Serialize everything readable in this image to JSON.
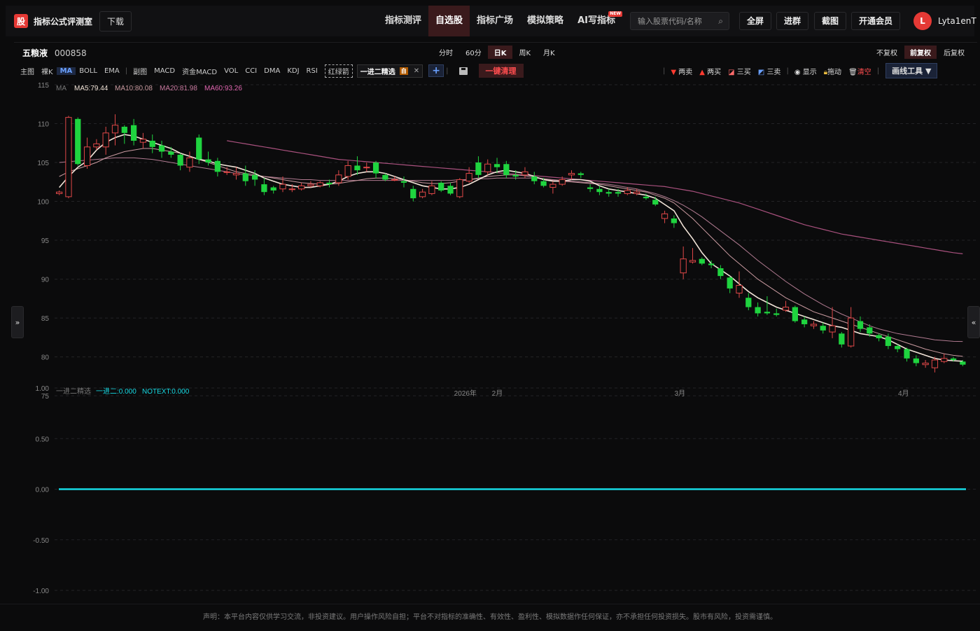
{
  "app": {
    "logo_char": "股",
    "brand": "指标公式评测室",
    "download": "下载"
  },
  "nav": {
    "items": [
      {
        "label": "指标测评"
      },
      {
        "label": "自选股",
        "active": true
      },
      {
        "label": "指标广场"
      },
      {
        "label": "模拟策略"
      },
      {
        "label": "AI写指标",
        "badge": "NEW"
      }
    ]
  },
  "search": {
    "placeholder": "输入股票代码/名称"
  },
  "top_buttons": {
    "fullscreen": "全屏",
    "join_group": "进群",
    "screenshot": "截图",
    "vip": "开通会员"
  },
  "user": {
    "avatar_letter": "L",
    "name": "Lyta1enT"
  },
  "stock": {
    "name": "五粮液",
    "code": "000858"
  },
  "periods": [
    "分时",
    "60分",
    "日K",
    "周K",
    "月K"
  ],
  "active_period": "日K",
  "adjust": [
    "不复权",
    "前复权",
    "后复权"
  ],
  "active_adjust": "前复权",
  "toolbar": {
    "main_label": "主图",
    "bare_k": "裸K",
    "ma": "MA",
    "boll": "BOLL",
    "ema": "EMA",
    "sub_label": "副图",
    "macd": "MACD",
    "fund_macd": "资金MACD",
    "vol": "VOL",
    "cci": "CCI",
    "dma": "DMA",
    "kdj": "KDJ",
    "rsi": "RSI",
    "red_green_arrow": "红绿箭",
    "chip_label": "一进二精选",
    "chip_badge": "自",
    "clear_all": "一键清理",
    "two_sell": "两卖",
    "two_buy": "两买",
    "three_buy": "三买",
    "three_sell": "三卖",
    "show": "显示",
    "drag": "拖动",
    "clear": "清空",
    "draw_tools": "画线工具 ▼"
  },
  "ma_legend": {
    "label": "MA",
    "ma5": "MA5:79.44",
    "ma10": "MA10:80.08",
    "ma20": "MA20:81.98",
    "ma60": "MA60:93.26"
  },
  "sub_legend": {
    "label": "一进二精选",
    "v1": "一进二:0.000",
    "v2": "NOTEXT:0.000"
  },
  "colors": {
    "up": "#e04848",
    "down": "#1fd43f",
    "ma5": "#f2e4d8",
    "ma10": "#c99aa0",
    "ma20": "#b07a90",
    "ma60": "#a9517e",
    "cyan": "#16d9e3",
    "accent_red": "#ff4d4f"
  },
  "chart_data": {
    "type": "candlestick",
    "ylim": [
      76,
      115
    ],
    "yticks": [
      115,
      110,
      105,
      100,
      95,
      90,
      85,
      80,
      75
    ],
    "xlabels": [
      "2026年",
      "2月",
      "3月",
      "4月"
    ],
    "candles": [
      [
        101.0,
        101.2,
        100.8,
        101.4
      ],
      [
        100.6,
        110.8,
        100.4,
        111.0
      ],
      [
        110.6,
        104.8,
        104.6,
        110.8
      ],
      [
        104.6,
        107.0,
        104.2,
        108.2
      ],
      [
        107.0,
        107.4,
        106.6,
        108.0
      ],
      [
        107.0,
        108.8,
        106.0,
        109.6
      ],
      [
        108.8,
        109.8,
        107.2,
        111.2
      ],
      [
        109.6,
        108.8,
        107.4,
        109.8
      ],
      [
        109.8,
        107.8,
        107.2,
        110.6
      ],
      [
        107.6,
        108.0,
        106.8,
        108.8
      ],
      [
        107.8,
        107.0,
        106.2,
        108.6
      ],
      [
        107.2,
        106.4,
        105.6,
        107.8
      ],
      [
        106.4,
        106.0,
        105.6,
        107.0
      ],
      [
        106.0,
        104.6,
        104.0,
        106.2
      ],
      [
        104.4,
        105.6,
        103.8,
        106.4
      ],
      [
        108.2,
        105.4,
        104.8,
        108.6
      ],
      [
        105.4,
        105.0,
        104.6,
        106.4
      ],
      [
        105.2,
        103.8,
        103.2,
        105.6
      ],
      [
        103.8,
        103.8,
        103.4,
        104.4
      ],
      [
        103.4,
        103.6,
        102.8,
        104.4
      ],
      [
        103.6,
        102.6,
        102.0,
        104.6
      ],
      [
        103.4,
        102.8,
        102.0,
        104.0
      ],
      [
        102.2,
        101.2,
        100.8,
        103.0
      ],
      [
        101.8,
        101.4,
        101.0,
        102.0
      ],
      [
        101.6,
        102.2,
        101.2,
        103.2
      ],
      [
        101.6,
        101.6,
        101.2,
        102.2
      ],
      [
        101.6,
        102.0,
        101.4,
        102.4
      ],
      [
        102.0,
        102.2,
        101.8,
        102.6
      ],
      [
        102.0,
        102.4,
        101.8,
        102.6
      ],
      [
        102.4,
        102.2,
        101.8,
        102.8
      ],
      [
        102.4,
        103.4,
        102.0,
        104.0
      ],
      [
        103.2,
        104.6,
        102.8,
        105.2
      ],
      [
        104.6,
        104.0,
        103.4,
        105.8
      ],
      [
        104.4,
        104.4,
        103.8,
        105.0
      ],
      [
        105.0,
        103.6,
        103.0,
        105.2
      ],
      [
        103.4,
        102.8,
        102.6,
        103.6
      ],
      [
        102.8,
        102.8,
        102.6,
        103.2
      ],
      [
        102.6,
        102.4,
        101.8,
        103.2
      ],
      [
        101.6,
        100.4,
        100.0,
        102.0
      ],
      [
        100.6,
        101.2,
        100.4,
        101.6
      ],
      [
        101.0,
        102.0,
        100.8,
        102.6
      ],
      [
        102.4,
        101.4,
        101.2,
        102.6
      ],
      [
        102.0,
        101.0,
        100.8,
        102.4
      ],
      [
        100.6,
        102.8,
        100.4,
        103.0
      ],
      [
        102.6,
        103.6,
        102.4,
        104.4
      ],
      [
        105.0,
        103.4,
        103.0,
        105.8
      ],
      [
        103.8,
        104.8,
        103.4,
        105.4
      ],
      [
        104.8,
        104.4,
        103.6,
        105.6
      ],
      [
        104.8,
        103.4,
        103.0,
        105.2
      ],
      [
        103.4,
        103.2,
        102.8,
        104.0
      ],
      [
        103.4,
        103.8,
        103.0,
        104.4
      ],
      [
        103.2,
        102.6,
        102.2,
        103.8
      ],
      [
        102.6,
        102.0,
        101.8,
        103.0
      ],
      [
        101.8,
        102.2,
        101.0,
        102.6
      ],
      [
        102.2,
        102.8,
        102.0,
        103.2
      ],
      [
        103.4,
        103.6,
        102.8,
        104.0
      ],
      [
        103.6,
        103.4,
        103.0,
        103.8
      ],
      [
        101.8,
        101.6,
        101.2,
        102.2
      ],
      [
        101.6,
        101.2,
        100.8,
        102.0
      ],
      [
        101.2,
        101.0,
        100.6,
        101.6
      ],
      [
        101.2,
        101.0,
        100.6,
        101.6
      ],
      [
        101.0,
        101.4,
        100.8,
        101.8
      ],
      [
        101.0,
        101.2,
        100.8,
        101.6
      ],
      [
        100.6,
        100.4,
        100.2,
        101.0
      ],
      [
        100.2,
        99.6,
        99.4,
        100.6
      ],
      [
        97.8,
        98.4,
        97.2,
        98.8
      ],
      [
        97.8,
        97.2,
        96.6,
        98.2
      ],
      [
        90.8,
        92.6,
        90.0,
        94.2
      ],
      [
        92.2,
        92.4,
        92.0,
        94.0
      ],
      [
        92.6,
        92.0,
        91.8,
        92.8
      ],
      [
        92.0,
        91.8,
        91.4,
        92.4
      ],
      [
        91.4,
        90.4,
        90.0,
        91.8
      ],
      [
        90.2,
        88.8,
        88.2,
        90.4
      ],
      [
        88.2,
        89.2,
        87.6,
        91.0
      ],
      [
        87.6,
        86.4,
        86.0,
        88.2
      ],
      [
        86.4,
        85.6,
        85.2,
        87.0
      ],
      [
        85.8,
        85.6,
        85.4,
        87.8
      ],
      [
        85.6,
        85.4,
        85.2,
        86.2
      ],
      [
        86.0,
        86.4,
        85.8,
        87.2
      ],
      [
        86.4,
        84.6,
        84.4,
        86.6
      ],
      [
        84.8,
        84.2,
        83.8,
        85.2
      ],
      [
        84.0,
        84.2,
        83.6,
        84.6
      ],
      [
        84.0,
        83.4,
        83.0,
        84.4
      ],
      [
        83.2,
        84.0,
        82.4,
        86.4
      ],
      [
        83.0,
        81.6,
        81.2,
        83.2
      ],
      [
        81.4,
        85.0,
        81.2,
        86.4
      ],
      [
        84.6,
        83.6,
        83.2,
        85.2
      ],
      [
        83.8,
        83.0,
        82.6,
        84.2
      ],
      [
        82.8,
        82.4,
        82.0,
        83.0
      ],
      [
        82.6,
        81.4,
        81.0,
        83.0
      ],
      [
        81.4,
        81.0,
        80.6,
        81.6
      ],
      [
        81.0,
        79.8,
        79.4,
        81.2
      ],
      [
        79.8,
        79.2,
        78.8,
        80.2
      ],
      [
        79.0,
        79.2,
        78.6,
        79.6
      ],
      [
        78.6,
        79.6,
        78.0,
        80.0
      ],
      [
        79.4,
        79.8,
        79.2,
        80.4
      ],
      [
        79.8,
        79.6,
        79.4,
        80.0
      ],
      [
        79.4,
        79.0,
        78.8,
        79.6
      ]
    ],
    "ma5": [
      101.8,
      103.2,
      104.4,
      105.2,
      106.6,
      107.6,
      108.2,
      108.6,
      108.4,
      108.0,
      107.6,
      107.2,
      106.8,
      106.2,
      105.8,
      105.4,
      105.2,
      104.8,
      104.6,
      104.4,
      104.0,
      103.6,
      103.0,
      102.6,
      102.2,
      102.0,
      101.8,
      101.8,
      102.0,
      102.2,
      102.6,
      103.2,
      103.6,
      103.8,
      103.8,
      103.6,
      103.2,
      102.8,
      102.4,
      102.0,
      101.8,
      101.6,
      101.6,
      101.8,
      102.2,
      102.8,
      103.4,
      103.8,
      104.0,
      103.8,
      103.6,
      103.2,
      102.8,
      102.6,
      102.6,
      102.8,
      102.8,
      102.6,
      102.0,
      101.6,
      101.4,
      101.2,
      101.0,
      100.8,
      100.4,
      99.6,
      98.8,
      96.8,
      95.2,
      93.4,
      92.0,
      91.2,
      90.4,
      89.4,
      88.4,
      87.6,
      87.0,
      86.4,
      86.0,
      85.6,
      85.2,
      84.8,
      84.4,
      84.0,
      83.8,
      83.4,
      83.0,
      82.8,
      82.6,
      82.2,
      81.6,
      81.0,
      80.6,
      80.2,
      79.8,
      79.6,
      79.5,
      79.44
    ],
    "ma10": [
      103.2,
      103.8,
      104.2,
      104.6,
      105.0,
      105.6,
      106.0,
      106.4,
      106.6,
      106.8,
      106.8,
      106.6,
      106.4,
      106.2,
      105.8,
      105.4,
      105.0,
      104.6,
      104.2,
      103.8,
      103.6,
      103.4,
      103.2,
      103.0,
      102.8,
      102.6,
      102.4,
      102.3,
      102.2,
      102.2,
      102.3,
      102.5,
      102.7,
      102.9,
      103.0,
      103.0,
      102.9,
      102.8,
      102.6,
      102.4,
      102.3,
      102.3,
      102.4,
      102.6,
      102.8,
      103.0,
      103.2,
      103.3,
      103.4,
      103.4,
      103.3,
      103.1,
      102.9,
      102.7,
      102.6,
      102.5,
      102.4,
      102.3,
      102.2,
      102.0,
      101.8,
      101.6,
      101.4,
      101.2,
      100.8,
      100.4,
      99.8,
      98.8,
      97.8,
      96.6,
      95.4,
      94.2,
      93.0,
      92.0,
      91.0,
      90.0,
      89.2,
      88.4,
      87.6,
      87.0,
      86.4,
      85.8,
      85.4,
      85.0,
      84.6,
      84.2,
      83.8,
      83.4,
      83.0,
      82.6,
      82.2,
      81.8,
      81.4,
      81.0,
      80.7,
      80.4,
      80.2,
      80.08
    ],
    "ma20": [
      105.0,
      105.1,
      105.2,
      105.3,
      105.4,
      105.5,
      105.6,
      105.6,
      105.6,
      105.5,
      105.4,
      105.2,
      105.0,
      104.8,
      104.6,
      104.4,
      104.2,
      104.0,
      103.8,
      103.6,
      103.4,
      103.3,
      103.2,
      103.1,
      103.0,
      102.9,
      102.8,
      102.8,
      102.7,
      102.7,
      102.7,
      102.7,
      102.7,
      102.7,
      102.7,
      102.7,
      102.7,
      102.7,
      102.7,
      102.7,
      102.7,
      102.7,
      102.7,
      102.8,
      102.8,
      102.9,
      102.9,
      103.0,
      103.0,
      103.0,
      103.0,
      103.0,
      102.9,
      102.8,
      102.7,
      102.6,
      102.5,
      102.4,
      102.3,
      102.2,
      102.0,
      101.8,
      101.6,
      101.3,
      101.0,
      100.6,
      100.1,
      99.5,
      98.8,
      98.0,
      97.1,
      96.2,
      95.3,
      94.4,
      93.4,
      92.4,
      91.5,
      90.6,
      89.7,
      88.9,
      88.1,
      87.4,
      86.7,
      86.1,
      85.5,
      85.0,
      84.5,
      84.0,
      83.6,
      83.3,
      83.0,
      82.8,
      82.6,
      82.4,
      82.2,
      82.1,
      82.0,
      81.98
    ],
    "ma60": [
      null,
      null,
      null,
      null,
      null,
      null,
      null,
      null,
      null,
      null,
      null,
      null,
      null,
      null,
      null,
      null,
      null,
      null,
      107.8,
      107.6,
      107.4,
      107.2,
      107.0,
      106.8,
      106.6,
      106.4,
      106.2,
      106.0,
      105.8,
      105.6,
      105.4,
      105.3,
      105.2,
      105.1,
      105.0,
      104.9,
      104.8,
      104.7,
      104.6,
      104.5,
      104.4,
      104.3,
      104.2,
      104.1,
      104.0,
      103.9,
      103.8,
      103.7,
      103.6,
      103.5,
      103.4,
      103.3,
      103.2,
      103.1,
      103.0,
      102.9,
      102.8,
      102.7,
      102.6,
      102.5,
      102.4,
      102.3,
      102.2,
      102.1,
      102.0,
      101.9,
      101.7,
      101.5,
      101.3,
      101.0,
      100.7,
      100.4,
      100.1,
      99.8,
      99.4,
      99.0,
      98.6,
      98.2,
      97.8,
      97.4,
      97.0,
      96.7,
      96.4,
      96.1,
      95.8,
      95.6,
      95.4,
      95.2,
      95.0,
      94.8,
      94.6,
      94.4,
      94.2,
      94.0,
      93.8,
      93.6,
      93.4,
      93.26
    ],
    "sub": {
      "ylim": [
        -1,
        1
      ],
      "yticks": [
        "1.00",
        "0.50",
        "0.00",
        "-0.50",
        "-1.00"
      ],
      "value": 0
    }
  },
  "disclaimer": "声明：本平台内容仅供学习交流，非投资建议。用户操作风险自担；平台不对指标的准确性、有效性、盈利性、模拟数据作任何保证，亦不承担任何投资损失。股市有风险，投资需谨慎。"
}
